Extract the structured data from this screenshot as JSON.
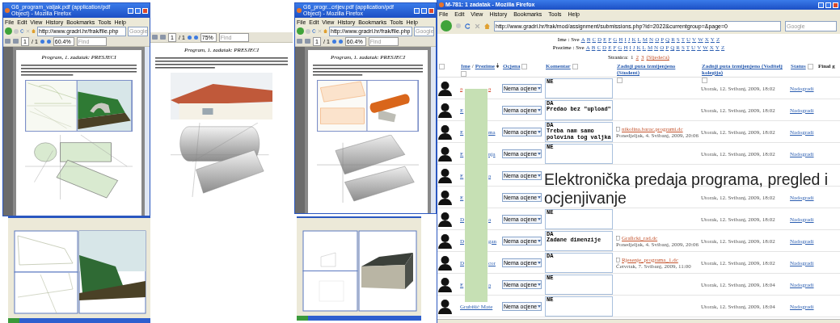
{
  "pdf_windows": [
    {
      "kind": "window",
      "title": "G6_program_valjak.pdf (application/pdf Object) - Mozilla Firefox",
      "menu": [
        "File",
        "Edit",
        "View",
        "History",
        "Bookmarks",
        "Tools",
        "Help"
      ],
      "url": "http://www.gradri.hr/frak/file.php",
      "search_placeholder": "Google",
      "page": "1",
      "page_total": "/ 1",
      "zoom": "60.4%",
      "find_placeholder": "Find",
      "heading": "Program, 1. zadatak: PRESJECI",
      "figures": [
        {
          "kind": "cad-views"
        },
        {
          "kind": "projection"
        }
      ]
    },
    {
      "kind": "page",
      "page": "1",
      "page_total": "/ 1",
      "zoom": "75%",
      "find_placeholder": "Find",
      "heading": "Program, 1. zadatak: PRESJECI",
      "figures": [
        {
          "kind": "photo"
        },
        {
          "kind": "cylinder"
        }
      ]
    },
    {
      "kind": "window",
      "title": "G6_progr...crijev.pdf (application/pdf Object) - Mozilla Firefox",
      "menu": [
        "File",
        "Edit",
        "View",
        "History",
        "Bookmarks",
        "Tools",
        "Help"
      ],
      "url": "http://www.gradri.hr/frak/file.php",
      "search_placeholder": "Google",
      "page": "1",
      "page_total": "/ 1",
      "zoom": "60.4%",
      "find_placeholder": "Find",
      "heading": "Program, 1. zadatak: PRESJECI",
      "figures": [
        {
          "kind": "pipe-cad"
        },
        {
          "kind": "cylinder-tilted"
        }
      ]
    }
  ],
  "cad_windows": [
    {
      "kind": "terrain"
    },
    {
      "kind": "box"
    }
  ],
  "browser": {
    "title": "M-781: 1 zadatak - Mozilla Firefox",
    "menu": [
      "File",
      "Edit",
      "View",
      "History",
      "Bookmarks",
      "Tools",
      "Help"
    ],
    "url": "http://www.gradri.hr/frak/mod/assignment/submissions.php?id=2022&currentgroup=&page=0",
    "search_placeholder": "Google",
    "filters": [
      {
        "label": "Ime : Sve",
        "letters": [
          "A",
          "B",
          "C",
          "D",
          "E",
          "F",
          "G",
          "H",
          "I",
          "J",
          "K",
          "L",
          "M",
          "N",
          "O",
          "P",
          "Q",
          "R",
          "S",
          "T",
          "U",
          "V",
          "W",
          "X",
          "Y",
          "Z"
        ]
      },
      {
        "label": "Prezime : Sve",
        "letters": [
          "A",
          "B",
          "C",
          "D",
          "E",
          "F",
          "G",
          "H",
          "I",
          "J",
          "K",
          "L",
          "M",
          "N",
          "O",
          "P",
          "Q",
          "R",
          "S",
          "T",
          "U",
          "V",
          "W",
          "X",
          "Y",
          "Z"
        ]
      }
    ],
    "pages": {
      "label": "Stranica:",
      "items": [
        {
          "text": "1",
          "selected": true
        },
        {
          "text": "2",
          "selected": false
        },
        {
          "text": "3",
          "selected": false
        }
      ],
      "next": "(Sljedeća)"
    },
    "columns": [
      {
        "parts": [
          "Ime",
          "Prezime"
        ],
        "separator": "/",
        "sort": true
      },
      {
        "parts": [
          "Ocjena"
        ],
        "sort": false
      },
      {
        "parts": [
          "Komentar"
        ],
        "sort": false
      },
      {
        "parts": [
          "Zadnji puta izmijenjeno (Student)"
        ],
        "sort": false
      },
      {
        "parts": [
          "Zadnji puta izmijenjeno (Voditelj kolegija)"
        ],
        "sort": false
      },
      {
        "parts": [
          "Status"
        ],
        "sort": false
      },
      {
        "parts": [
          "Final g"
        ],
        "sort": false,
        "plain": true
      }
    ],
    "rows": [
      {
        "name_start": "a",
        "name_end": "a",
        "highlighted": true,
        "grade": "Nema ocjene",
        "comment": "NE",
        "teacher_date": "Utorak, 12. Svibanj, 2009, 18:02",
        "status": "Nadogradi"
      },
      {
        "name_start": "E",
        "highlighted": false,
        "grade": "Nema ocjene",
        "comment": "DA\nPredao bez \"upload\"",
        "teacher_date": "Utorak, 12. Svibanj, 2009, 18:02",
        "status": "Nadogradi"
      },
      {
        "name_start": "E",
        "name_end": "ma",
        "highlighted": false,
        "grade": "Nema ocjene",
        "comment": "DA\nTreba nam samo\npolovina tog valjka",
        "file": "nikolina.barac.programi.dc",
        "file_date": "Ponedjeljak, 4. Svibanj, 2009, 20:06",
        "teacher_date": "Utorak, 12. Svibanj, 2009, 18:02",
        "status": "Nadogradi"
      },
      {
        "name_start": "E",
        "name_end": "nja",
        "highlighted": false,
        "grade": "Nema ocjene",
        "comment": "NE",
        "teacher_date": "Utorak, 12. Svibanj, 2009, 18:02",
        "status": "Nadogradi"
      },
      {
        "name_start": "E",
        "name_end": "a",
        "highlighted": false,
        "grade": "Nema ocjene"
      },
      {
        "name_start": "E",
        "highlighted": false,
        "grade": "Nema ocjene",
        "teacher_date": "Utorak, 12. Svibanj, 2009, 18:02",
        "status": "Nadogradi"
      },
      {
        "name_start": "D",
        "name_end": "a",
        "highlighted": false,
        "grade": "Nema ocjene",
        "comment": "NE",
        "teacher_date": "Utorak, 12. Svibanj, 2009, 18:02",
        "status": "Nadogradi"
      },
      {
        "name_start": "D",
        "name_end": "gan",
        "highlighted": false,
        "grade": "Nema ocjene",
        "comment": "DA\nZadane dimenzije",
        "file": "Graficki_rad.dc",
        "file_date": "Ponedjeljak, 4. Svibanj, 2009, 20:06",
        "teacher_date": "Utorak, 12. Svibanj, 2009, 18:02",
        "status": "Nadogradi"
      },
      {
        "name_start": "D",
        "name_end": "cor",
        "highlighted": false,
        "grade": "Nema ocjene",
        "comment": "DA",
        "file": "Rjesenje_programa_1.dc",
        "file_date": "Četvrtak, 7. Svibanj, 2009, 11:00",
        "teacher_date": "Utorak, 12. Svibanj, 2009, 18:02",
        "status": "Nadogradi"
      },
      {
        "name_start": "E",
        "name_end": "a",
        "highlighted": false,
        "grade": "Nema ocjene",
        "comment": "NE",
        "teacher_date": "Utorak, 12. Svibanj, 2009, 18:04",
        "status": "Nadogradi"
      },
      {
        "name_start": "Grubišić Mate",
        "highlighted": false,
        "grade": "Nema ocjene",
        "comment": "NE",
        "teacher_date": "Utorak, 12. Svibanj, 2009, 18:04",
        "status": "Nadogradi"
      }
    ]
  },
  "caption_lines": [
    "Elektronička predaja programa, pregled i",
    "ocjenjivanje"
  ]
}
